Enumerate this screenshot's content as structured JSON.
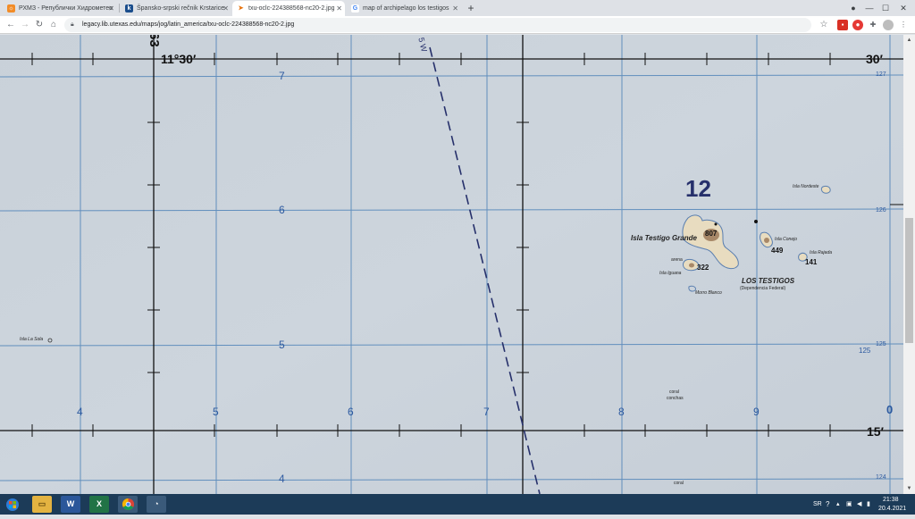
{
  "browser": {
    "tabs": [
      {
        "label": "РХМЗ - Републички Хидрометео",
        "favicon": "rhmz-favicon",
        "color": "#f28c28"
      },
      {
        "label": "Špansko-srpski rečnik Krstarice",
        "favicon": "k",
        "color": "#1a4d8c"
      },
      {
        "label": "txu-oclc-224388568-nc20-2.jpg",
        "favicon": "",
        "color": "#e8710a"
      },
      {
        "label": "map of archipelago los testigos",
        "favicon": "G",
        "color": "#4285f4"
      }
    ],
    "new_tab": "+",
    "address": "legacy.lib.utexas.edu/maps/jog/latin_america/txu-oclc-224388568-nc20-2.jpg"
  },
  "map": {
    "degree_labels": {
      "lat_left": "11°30′",
      "lon_top": "63",
      "right_top": "30′",
      "right_bottom": "15′",
      "right_zero": "0"
    },
    "grid_x_labels": [
      "4",
      "5",
      "6",
      "7",
      "8",
      "9"
    ],
    "grid_y_labels": [
      "7",
      "6",
      "5",
      "4"
    ],
    "edge_small": {
      "e127": "127",
      "e126": "126",
      "e125a": "125",
      "e125b": "125",
      "e124": "124"
    },
    "dashed_line_label": "5 W",
    "big_number": "12",
    "places": {
      "grande": "Isla Testigo Grande",
      "nordeste": "Isla Nordeste",
      "conejo": "Isla Conejo",
      "rajada": "Isla Rajada",
      "iguana": "Isla Iguana",
      "arena": "arena",
      "morro": "Morro Blanco",
      "los_testigos": "LOS TESTIGOS",
      "dependencia": "(Dependencia Federal)",
      "la_sola": "Isla La Sola",
      "coral1": "coral",
      "conchas": "conchas",
      "coral2": "coral"
    },
    "elevations": {
      "e807": "807",
      "e449": "449",
      "e322": "322",
      "e141": "141"
    }
  },
  "taskbar": {
    "lang": "SR",
    "time": "21:38",
    "date": "20.4.2021"
  }
}
